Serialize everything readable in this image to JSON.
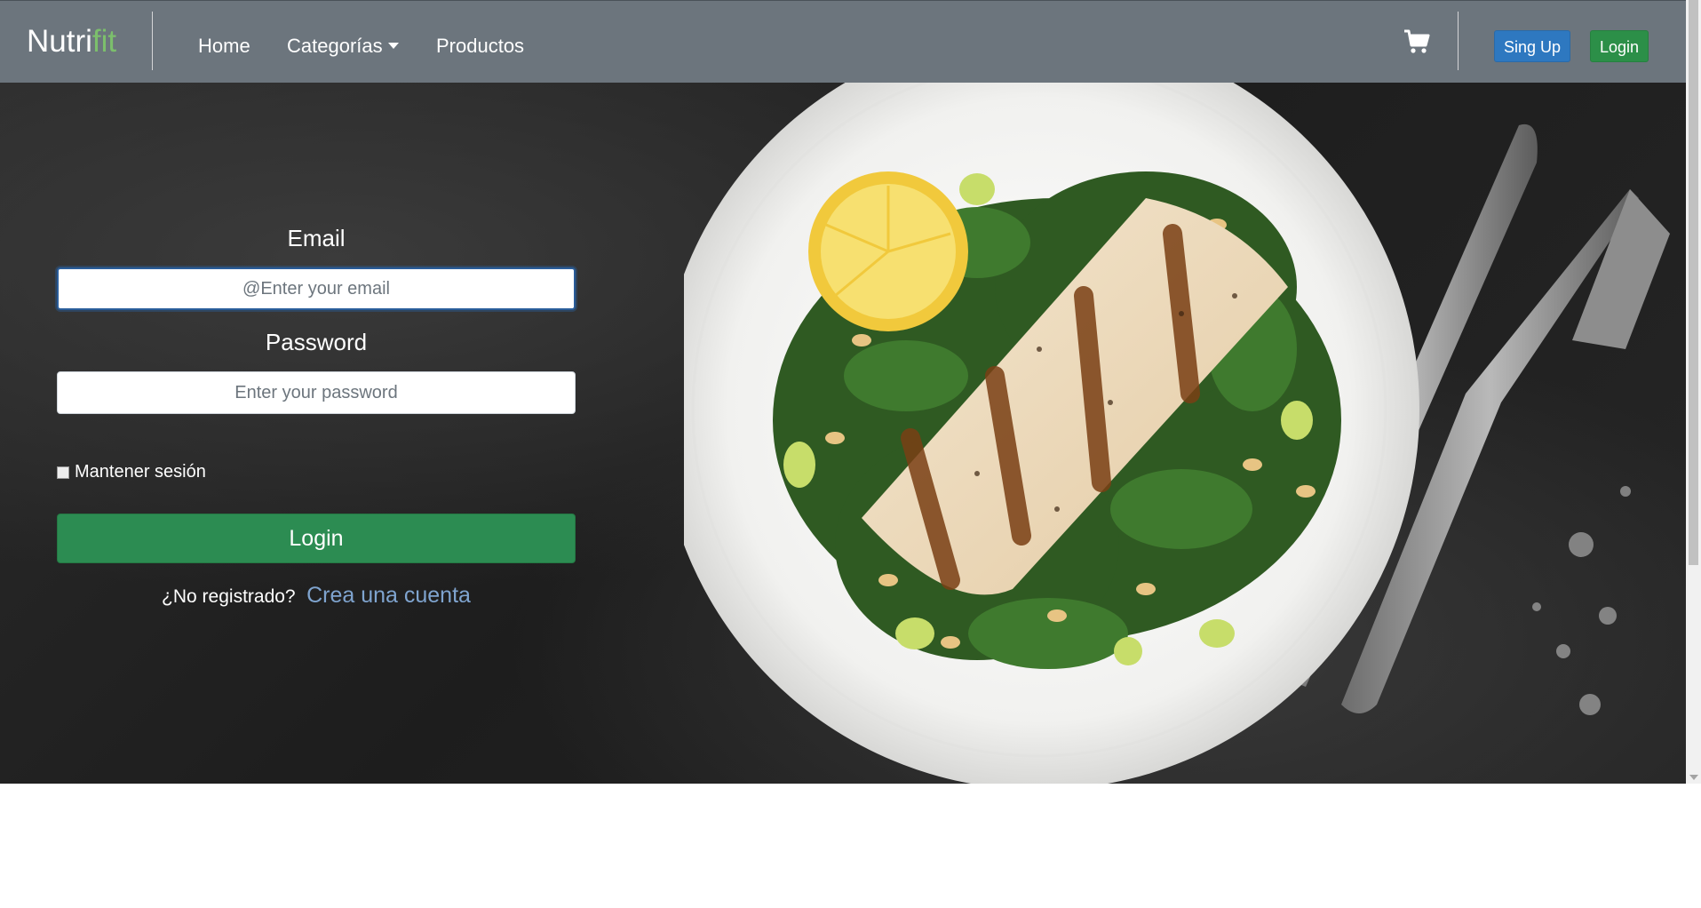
{
  "brand": {
    "part1": "Nutri",
    "part2": "fit"
  },
  "nav": {
    "home": "Home",
    "categories": "Categorías",
    "products": "Productos",
    "signup": "Sing Up",
    "login": "Login"
  },
  "form": {
    "email_label": "Email",
    "email_placeholder": "@Enter your email",
    "password_label": "Password",
    "password_placeholder": "Enter your password",
    "remember": "Mantener sesión",
    "submit": "Login",
    "not_registered": "¿No registrado?",
    "create_account": "Crea una cuenta"
  },
  "colors": {
    "navbar": "#6c757d",
    "brand_accent": "#7cbf6c",
    "signup_button": "#2e78c0",
    "login_button": "#2c8c52",
    "link": "#7fa4cf"
  },
  "icons": {
    "cart": "cart-icon"
  }
}
